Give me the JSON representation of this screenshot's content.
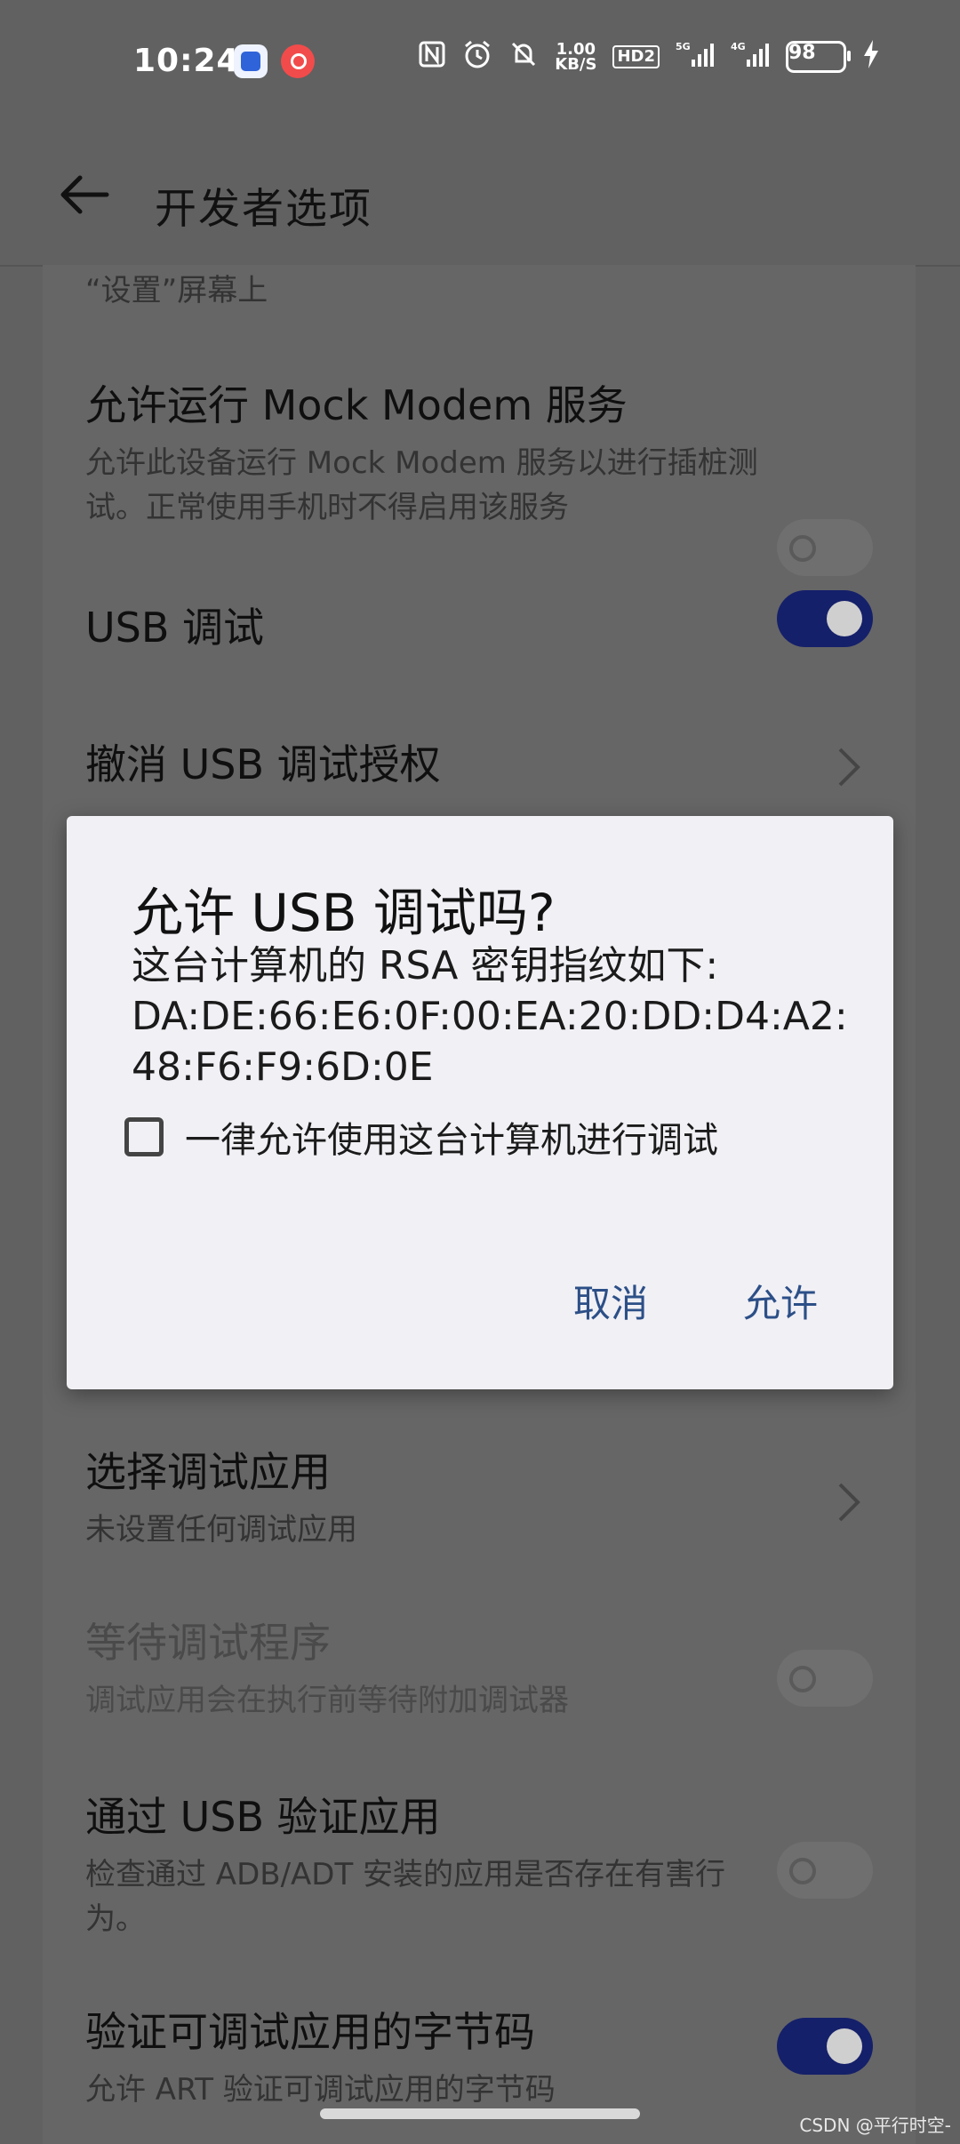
{
  "status_bar": {
    "time": "10:24",
    "net_speed": "1.00\nKB/S",
    "hd_label": "HD2",
    "signal1": "5G",
    "signal2": "4G",
    "battery": "98"
  },
  "app_bar": {
    "title": "开发者选项"
  },
  "list": {
    "top_fragment": "“设置”屏幕上",
    "items": [
      {
        "title": "允许运行 Mock Modem 服务",
        "subtitle": "允许此设备运行 Mock Modem 服务以进行插桩测试。正常使用手机时不得启用该服务",
        "toggle": "off"
      },
      {
        "title": "USB 调试",
        "toggle": "on"
      },
      {
        "title": "撤消 USB 调试授权"
      },
      {
        "title": "选择调试应用",
        "subtitle": "未设置任何调试应用"
      },
      {
        "title": "等待调试程序",
        "subtitle": "调试应用会在执行前等待附加调试器",
        "toggle": "off",
        "disabled": true
      },
      {
        "title": "通过 USB 验证应用",
        "subtitle": "检查通过 ADB/ADT 安装的应用是否存在有害行为。",
        "toggle": "off"
      },
      {
        "title": "验证可调试应用的字节码",
        "subtitle": "允许 ART 验证可调试应用的字节码",
        "toggle": "on"
      }
    ]
  },
  "dialog": {
    "title": "允许 USB 调试吗?",
    "body": "这台计算机的 RSA 密钥指纹如下:\nDA:DE:66:E6:0F:00:EA:20:DD:D4:A2:\n48:F6:F9:6D:0E",
    "checkbox_label": "一律允许使用这台计算机进行调试",
    "checkbox_checked": false,
    "cancel_label": "取消",
    "allow_label": "允许"
  },
  "watermark": "CSDN @平行时空-"
}
